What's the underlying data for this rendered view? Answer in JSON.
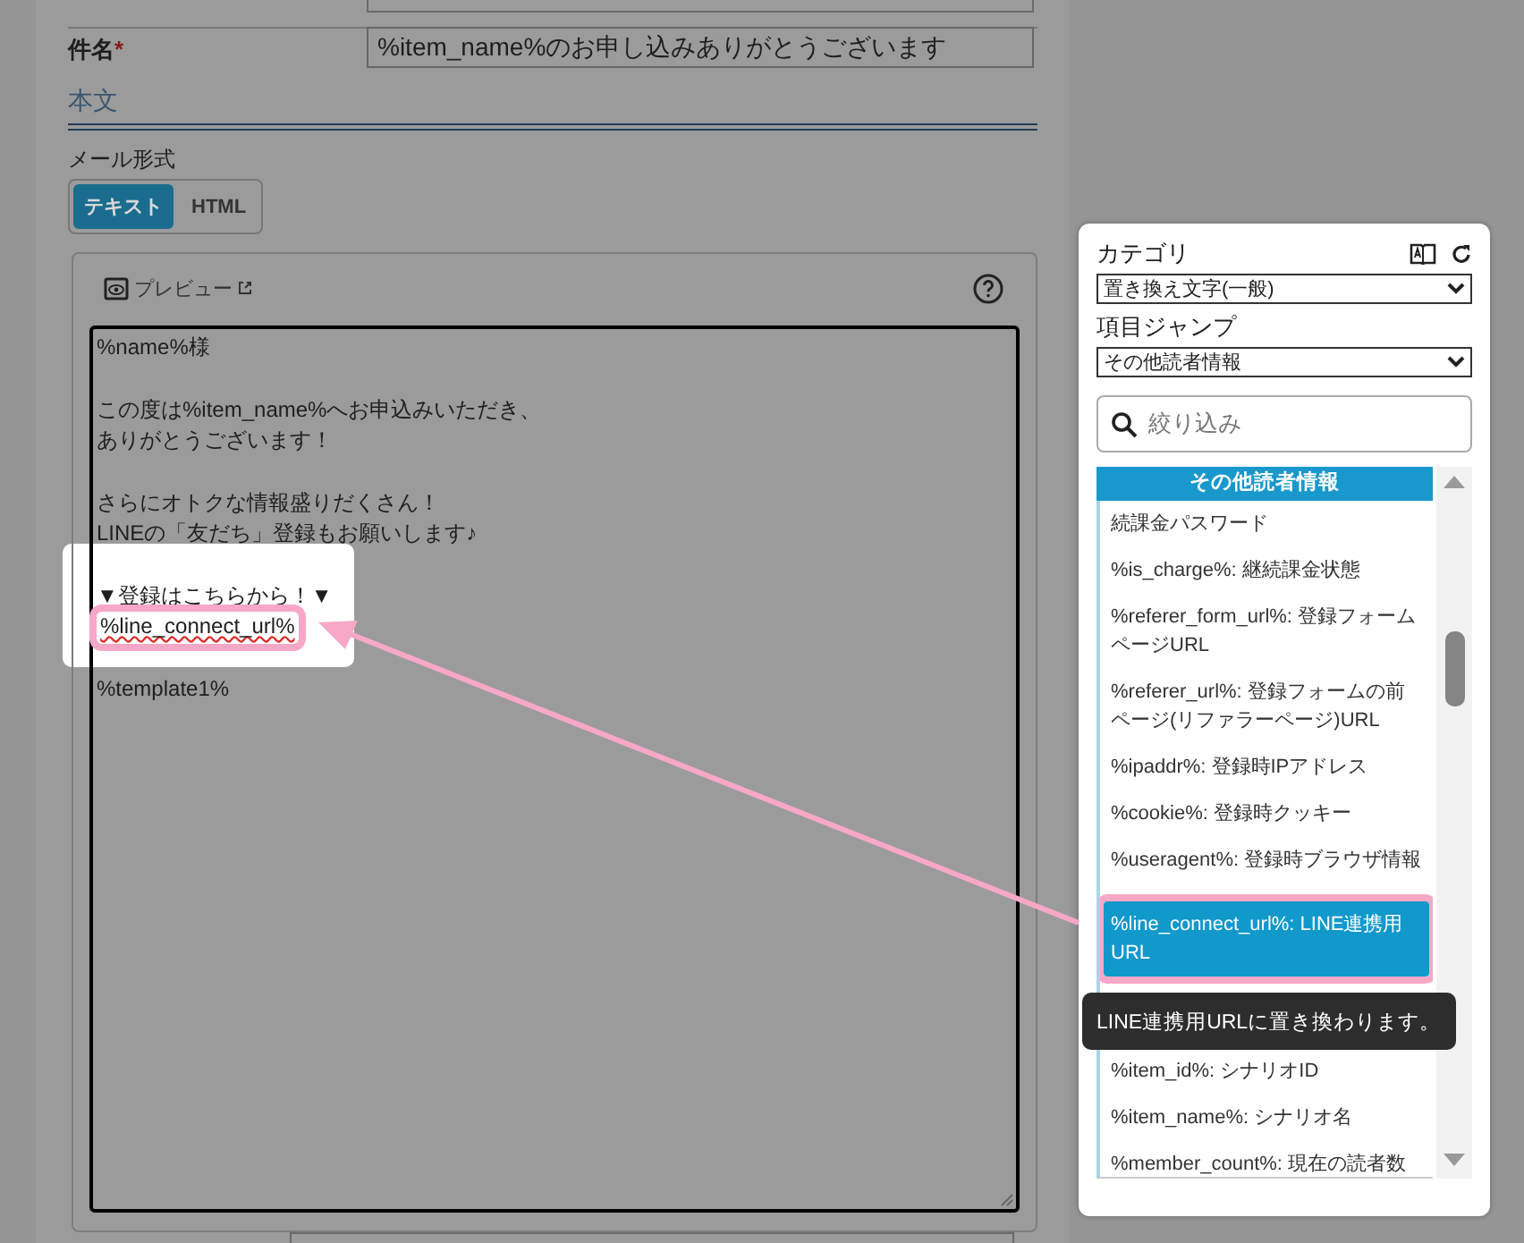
{
  "subject": {
    "label": "件名",
    "required_mark": "*",
    "value": "%item_name%のお申し込みありがとうございます"
  },
  "body_section": {
    "title": "本文",
    "format_label": "メール形式",
    "formats": [
      {
        "label": "テキスト",
        "selected": true
      },
      {
        "label": "HTML",
        "selected": false
      }
    ],
    "preview_link": "プレビュー",
    "paragraphs": [
      {
        "spotlight": false,
        "lines": [
          {
            "text": "%name%様",
            "marked": false
          }
        ]
      },
      {
        "spotlight": false,
        "lines": [
          {
            "text": "この度は%item_name%へお申込みいただき、",
            "marked": false
          },
          {
            "text": "ありがとうございます！",
            "marked": false
          }
        ]
      },
      {
        "spotlight": false,
        "lines": [
          {
            "text": "さらにオトクな情報盛りだくさん！",
            "marked": false
          },
          {
            "text": "LINEの「友だち」登録もお願いします♪",
            "marked": false
          }
        ]
      },
      {
        "spotlight": true,
        "lines": [
          {
            "text": "▼登録はこちらから！▼",
            "marked": false
          },
          {
            "text": "%line_connect_url%",
            "marked": true
          }
        ]
      },
      {
        "spotlight": false,
        "lines": [
          {
            "text": "%template1%",
            "marked": false
          }
        ]
      }
    ]
  },
  "side_panel": {
    "category_label": "カテゴリ",
    "category_value": "置き換え文字(一般)",
    "jump_label": "項目ジャンプ",
    "jump_value": "その他読者情報",
    "search_placeholder": "絞り込み",
    "list_heading": "その他読者情報",
    "items": [
      {
        "text": "続課金パスワード",
        "selected": false
      },
      {
        "text": "%is_charge%: 継続課金状態",
        "selected": false
      },
      {
        "text": "%referer_form_url%: 登録フォームページURL",
        "selected": false
      },
      {
        "text": "%referer_url%: 登録フォームの前ページ(リファラーページ)URL",
        "selected": false
      },
      {
        "text": "%ipaddr%: 登録時IPアドレス",
        "selected": false
      },
      {
        "text": "%cookie%: 登録時クッキー",
        "selected": false
      },
      {
        "text": "%useragent%: 登録時ブラウザ情報",
        "selected": false
      },
      {
        "text": "%line_connect_url%: LINE連携用URL",
        "selected": true
      },
      {
        "text": "%item_id%: シナリオID",
        "selected": false
      },
      {
        "text": "%item_name%: シナリオ名",
        "selected": false
      },
      {
        "text": "%member_count%: 現在の読者数",
        "selected": false
      }
    ],
    "tooltip": "LINE連携用URLに置き換わります。"
  }
}
